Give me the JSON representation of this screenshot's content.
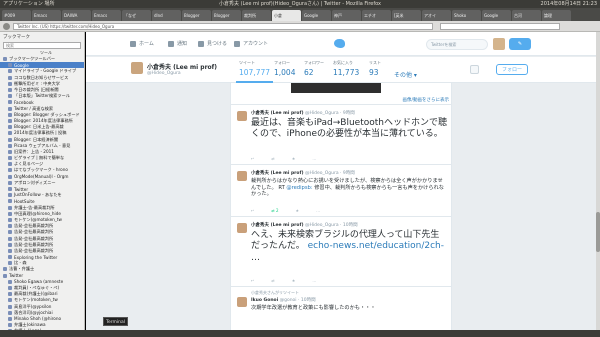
{
  "window": {
    "title": "小倉秀夫 (Lee mi prof)(Hideo_Oguraさん) | Twitter - Mozilla Firefox",
    "app_menu": "アプリケーション 場所",
    "tray": "2014年08月14日 21:23"
  },
  "tabs": [
    {
      "label": "#009"
    },
    {
      "label": "Emacs"
    },
    {
      "label": "DAIWA"
    },
    {
      "label": "Emacs"
    },
    {
      "label": "「なぜ"
    },
    {
      "label": "dlnd"
    },
    {
      "label": "Blogger"
    },
    {
      "label": "Blogger"
    },
    {
      "label": "裁判所"
    },
    {
      "label": "小倉"
    },
    {
      "label": "Google"
    },
    {
      "label": "神戸"
    },
    {
      "label": "エチオ"
    },
    {
      "label": "[英米"
    },
    {
      "label": "アオイ"
    },
    {
      "label": "Shoko"
    },
    {
      "label": "Google"
    },
    {
      "label": "古河"
    },
    {
      "label": "論理"
    }
  ],
  "urlbar": {
    "value": "Twitter Inc. (US)  https://twitter.com/Hideo_Ogura"
  },
  "sidebar": {
    "header": "ブックマーク",
    "search_placeholder": "検索",
    "tools": "ツール",
    "items": [
      {
        "label": "ブックマークツールバー"
      },
      {
        "label": "Google",
        "selected": true
      },
      {
        "label": "マイドライブ - Google ドライブ"
      },
      {
        "label": "ココな数日お知らせサービス"
      },
      {
        "label": "衝撃所用ゼミ : 中央大学"
      },
      {
        "label": "今日の裁判所 |日経新聞"
      },
      {
        "label": "「日本版」Twitter検索ツール"
      },
      {
        "label": "Facebook"
      },
      {
        "label": "Twitter / 高速な検索"
      },
      {
        "label": "Blogger: Blogger ダッシュボード"
      },
      {
        "label": "Blogger: 2014年度法律事務所"
      },
      {
        "label": "Blogger: 日米上告-最高裁"
      },
      {
        "label": "2014年度法律事務所 | 投稿"
      },
      {
        "label": "Blogger: 日本経済新聞"
      },
      {
        "label": "Picasa ウェブアルバム - 意見"
      },
      {
        "label": "旧案件：上告 - 2011"
      },
      {
        "label": "ビゲライブ | 無料で簡単な"
      },
      {
        "label": "よく見るページ"
      },
      {
        "label": "はてなブックマーク - hrono"
      },
      {
        "label": "OrgMode(Manual)l - Orgm"
      },
      {
        "label": "アポロン対ディズニー"
      },
      {
        "label": "Twitter"
      },
      {
        "label": "JustOnFollow - あなたを"
      },
      {
        "label": "HootSuite"
      },
      {
        "label": "弁護士-告-最高裁判所"
      },
      {
        "label": "中田真理(@hirono_hide"
      },
      {
        "label": "モトケン(@motoken_tw"
      },
      {
        "label": "告発-会社最高裁判所"
      },
      {
        "label": "告発-会社最高裁判所"
      },
      {
        "label": "告発-会社最高裁判所"
      },
      {
        "label": "告発-会社最高裁判所"
      },
      {
        "label": "告発-会社最高裁判所"
      },
      {
        "label": "Exploring the Twitter"
      },
      {
        "label": "比 - 森"
      },
      {
        "label": "法曹・弁護士"
      },
      {
        "label": "Twitter"
      },
      {
        "label": "Shoko Egawa (amneste"
      },
      {
        "label": "裁判員(・ぺなゅぐ・ぺ)"
      },
      {
        "label": "最高裁(弁護士)(@ibari"
      },
      {
        "label": "モトケン(motoken_tw"
      },
      {
        "label": "高島洋平(@ypsilon"
      },
      {
        "label": "落合洋司(@yjochiai"
      },
      {
        "label": "Minako Shoh (@hirono"
      },
      {
        "label": "弁護士(okinawa"
      },
      {
        "label": "弁護士 (Lego)"
      },
      {
        "label": "弁護士 (Amore"
      },
      {
        "label": "弁護士 (@ke"
      }
    ]
  },
  "twitter_nav": {
    "home": "ホーム",
    "notifications": "通知",
    "discover": "見つける",
    "account": "アカウント",
    "search_placeholder": "Twitterを検索",
    "tweet_button": "✎"
  },
  "profile": {
    "name": "小倉秀夫 (Lee mi prof)",
    "handle": "@Hideo_Ogura",
    "stats": [
      {
        "label": "ツイート",
        "value": "107,777",
        "selected": true
      },
      {
        "label": "フォロー",
        "value": "1,004"
      },
      {
        "label": "フォロワー",
        "value": "62"
      },
      {
        "label": "お気に入り",
        "value": "11,773"
      },
      {
        "label": "リスト",
        "value": "93"
      }
    ],
    "more": "その他",
    "follow_button": "フォロー"
  },
  "timeline": {
    "media_link": "画像/動画をさらに表示",
    "tweets": [
      {
        "name": "小倉秀夫 (Lee mi prof)",
        "handle": "@Hideo_Ogura · 9時間",
        "text": "最近は、音楽もiPad→Bluetoothヘッドホンで聴くので、iPhoneの必要性が本当に薄れている。",
        "reply": "↩",
        "retweet": "⇄",
        "retweet_count": "",
        "favorite": "★",
        "more": "…"
      },
      {
        "name": "小倉秀夫 (Lee mi prof)",
        "handle": "@Hideo_Ogura · 9時間",
        "text": "裁判所からはかなり熱心にお誘いを受けましたが、検察からは全く声がかかりませんでした。",
        "rt_prefix": "RT",
        "rt_mention": "@redipsb:",
        "rt_text": "修習中、裁判所からも検察からも一言も声をかけられなかった。",
        "reply": "↩",
        "retweet": "⇄",
        "retweet_count": "2",
        "favorite": "★",
        "more": "…"
      },
      {
        "name": "小倉秀夫 (Lee mi prof)",
        "handle": "@Hideo_Ogura · 10時間",
        "text": "へえ、未来検索ブラジルの代理人って山下先生だったんだ。",
        "link": "echo-news.net/education/2ch-",
        "link_suffix": "…",
        "reply": "↩",
        "retweet": "⇄",
        "retweet_count": "",
        "favorite": "★",
        "more": "…"
      },
      {
        "retweeted_by": "小倉秀夫さんがリツイート",
        "name": "Ikuo Gonoi",
        "handle": "@gonoi · 10時間",
        "text": "次期学年改選が教育と政策にも影響したのかも・・・"
      }
    ]
  },
  "dock": {
    "tooltip": "Terminal"
  }
}
